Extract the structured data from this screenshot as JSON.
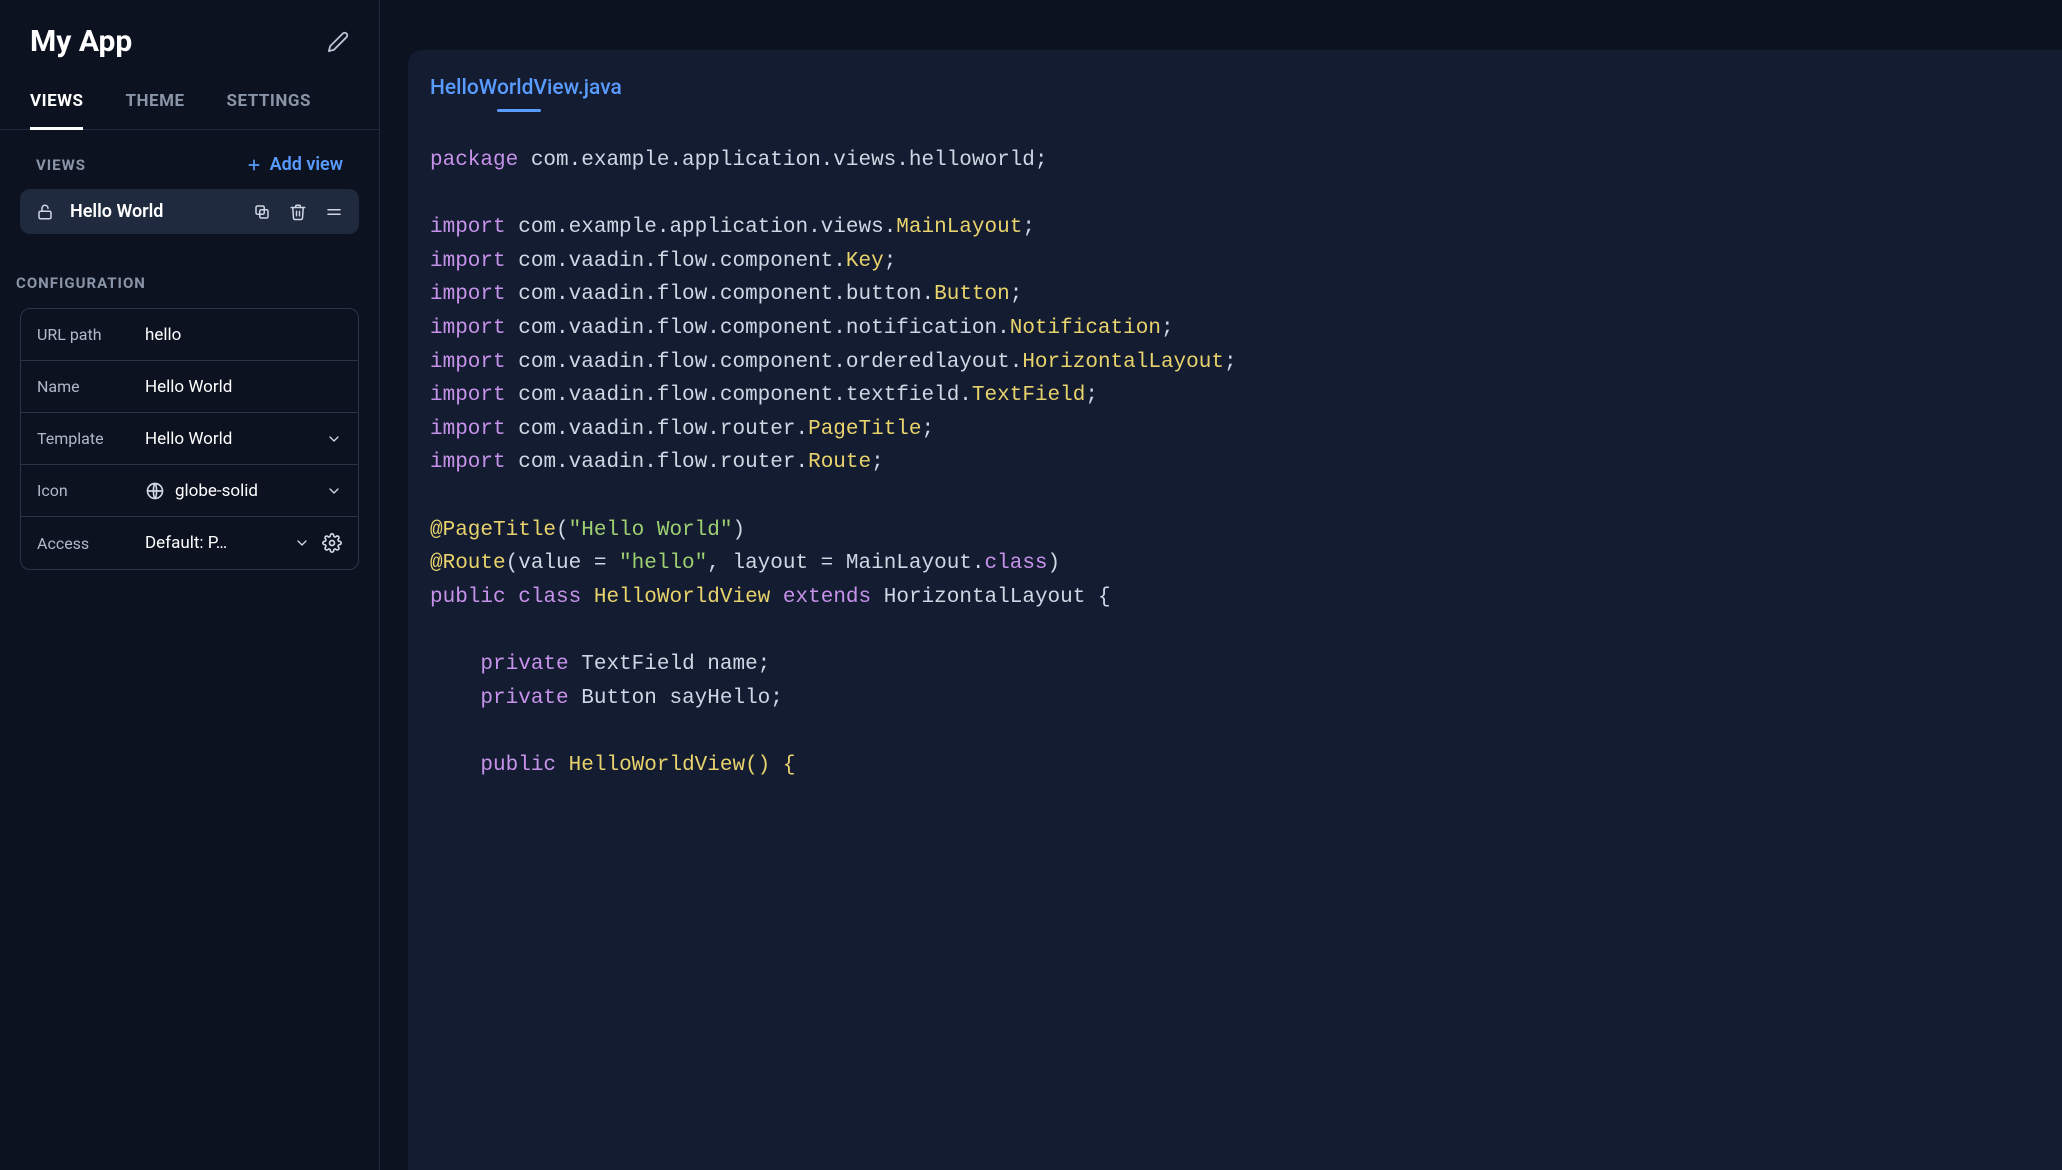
{
  "app": {
    "title": "My App"
  },
  "tabs": {
    "views": "VIEWS",
    "theme": "THEME",
    "settings": "SETTINGS"
  },
  "sections": {
    "views": "VIEWS",
    "configuration": "CONFIGURATION"
  },
  "addView": "Add view",
  "viewItem": {
    "label": "Hello World"
  },
  "config": {
    "urlPath": {
      "key": "URL path",
      "value": "hello"
    },
    "name": {
      "key": "Name",
      "value": "Hello World"
    },
    "template": {
      "key": "Template",
      "value": "Hello World"
    },
    "icon": {
      "key": "Icon",
      "value": "globe-solid"
    },
    "access": {
      "key": "Access",
      "value": "Default: P…"
    }
  },
  "editor": {
    "fileName": "HelloWorldView.java"
  },
  "code": {
    "package_kw": "package",
    "package_path": "com.example.application.views.helloworld;",
    "import_kw": "import",
    "imp1a": "com.example.application.views.",
    "imp1b": "MainLayout",
    "imp1c": ";",
    "imp2a": "com.vaadin.flow.component.",
    "imp2b": "Key",
    "imp2c": ";",
    "imp3a": "com.vaadin.flow.component.button.",
    "imp3b": "Button",
    "imp3c": ";",
    "imp4a": "com.vaadin.flow.component.notification.",
    "imp4b": "Notification",
    "imp4c": ";",
    "imp5a": "com.vaadin.flow.component.orderedlayout.",
    "imp5b": "HorizontalLayout",
    "imp5c": ";",
    "imp6a": "com.vaadin.flow.component.textfield.",
    "imp6b": "TextField",
    "imp6c": ";",
    "imp7a": "com.vaadin.flow.router.",
    "imp7b": "PageTitle",
    "imp7c": ";",
    "imp8a": "com.vaadin.flow.router.",
    "imp8b": "Route",
    "imp8c": ";",
    "ann1a": "@PageTitle",
    "ann1b": "(",
    "ann1c": "\"Hello World\"",
    "ann1d": ")",
    "ann2a": "@Route",
    "ann2b": "(value = ",
    "ann2c": "\"hello\"",
    "ann2d": ", layout = MainLayout.",
    "ann2e": "class",
    "ann2f": ")",
    "decl1": "public",
    "decl2": "class",
    "decl3": "HelloWorldView",
    "decl4": "extends",
    "decl5": "HorizontalLayout {",
    "fld1a": "private",
    "fld1b": "TextField name;",
    "fld2a": "private",
    "fld2b": "Button sayHello;",
    "ctor1": "public",
    "ctor2": "HelloWorldView() {"
  }
}
